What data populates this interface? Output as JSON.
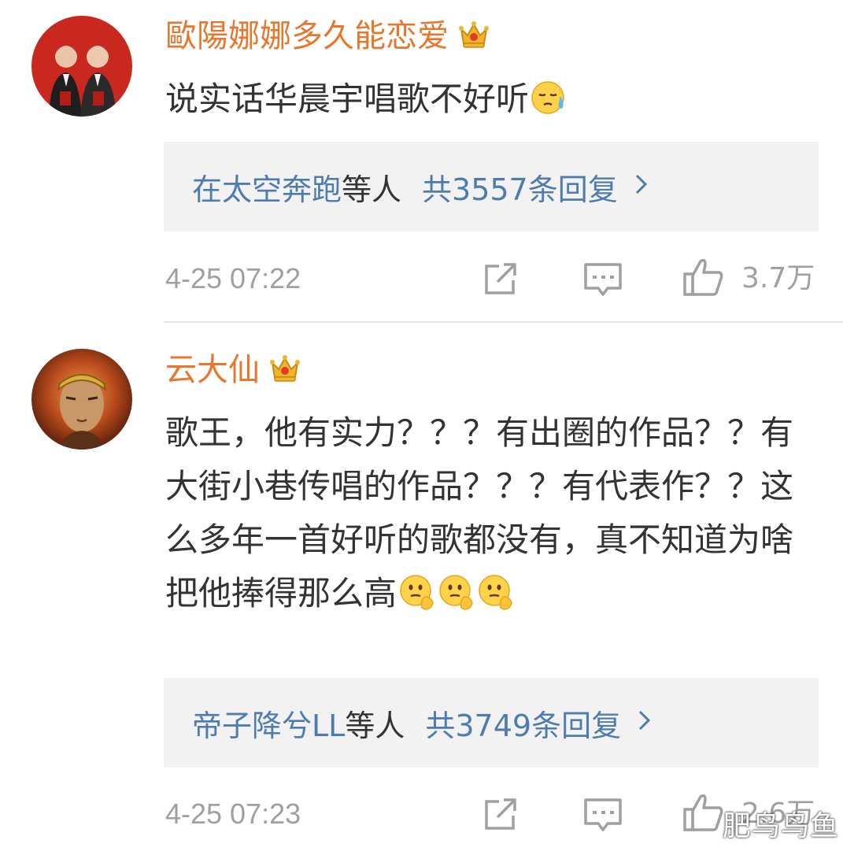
{
  "comments": [
    {
      "username": "歐陽娜娜多久能恋爱",
      "text": "说实话华晨宇唱歌不好听",
      "reply_users": "在太空奔跑",
      "reply_mid": "等人",
      "reply_count": "共3557条回复",
      "time": "4-25 07:22",
      "likes": "3.7万"
    },
    {
      "username": "云大仙",
      "text": "歌王，他有实力？？？有出圈的作品？？有大街小巷传唱的作品？？？有代表作？？这么多年一首好听的歌都没有，真不知道为啥把他捧得那么高",
      "reply_users": "帝子降兮LL",
      "reply_mid": "等人",
      "reply_count": "共3749条回复",
      "time": "4-25 07:23",
      "likes": "2.6万"
    }
  ],
  "watermark": "肥鸟鸟鱼",
  "icons": {
    "crown": "crown-badge-icon",
    "repost": "repost-icon",
    "comment": "comment-icon",
    "like": "thumbs-up-icon",
    "chevron": "chevron-right-icon"
  },
  "colors": {
    "username": "#e8772d",
    "reply_link": "#4f7cae",
    "text": "#333333",
    "meta": "#a0a0a0",
    "reply_bg": "#f2f2f2"
  }
}
